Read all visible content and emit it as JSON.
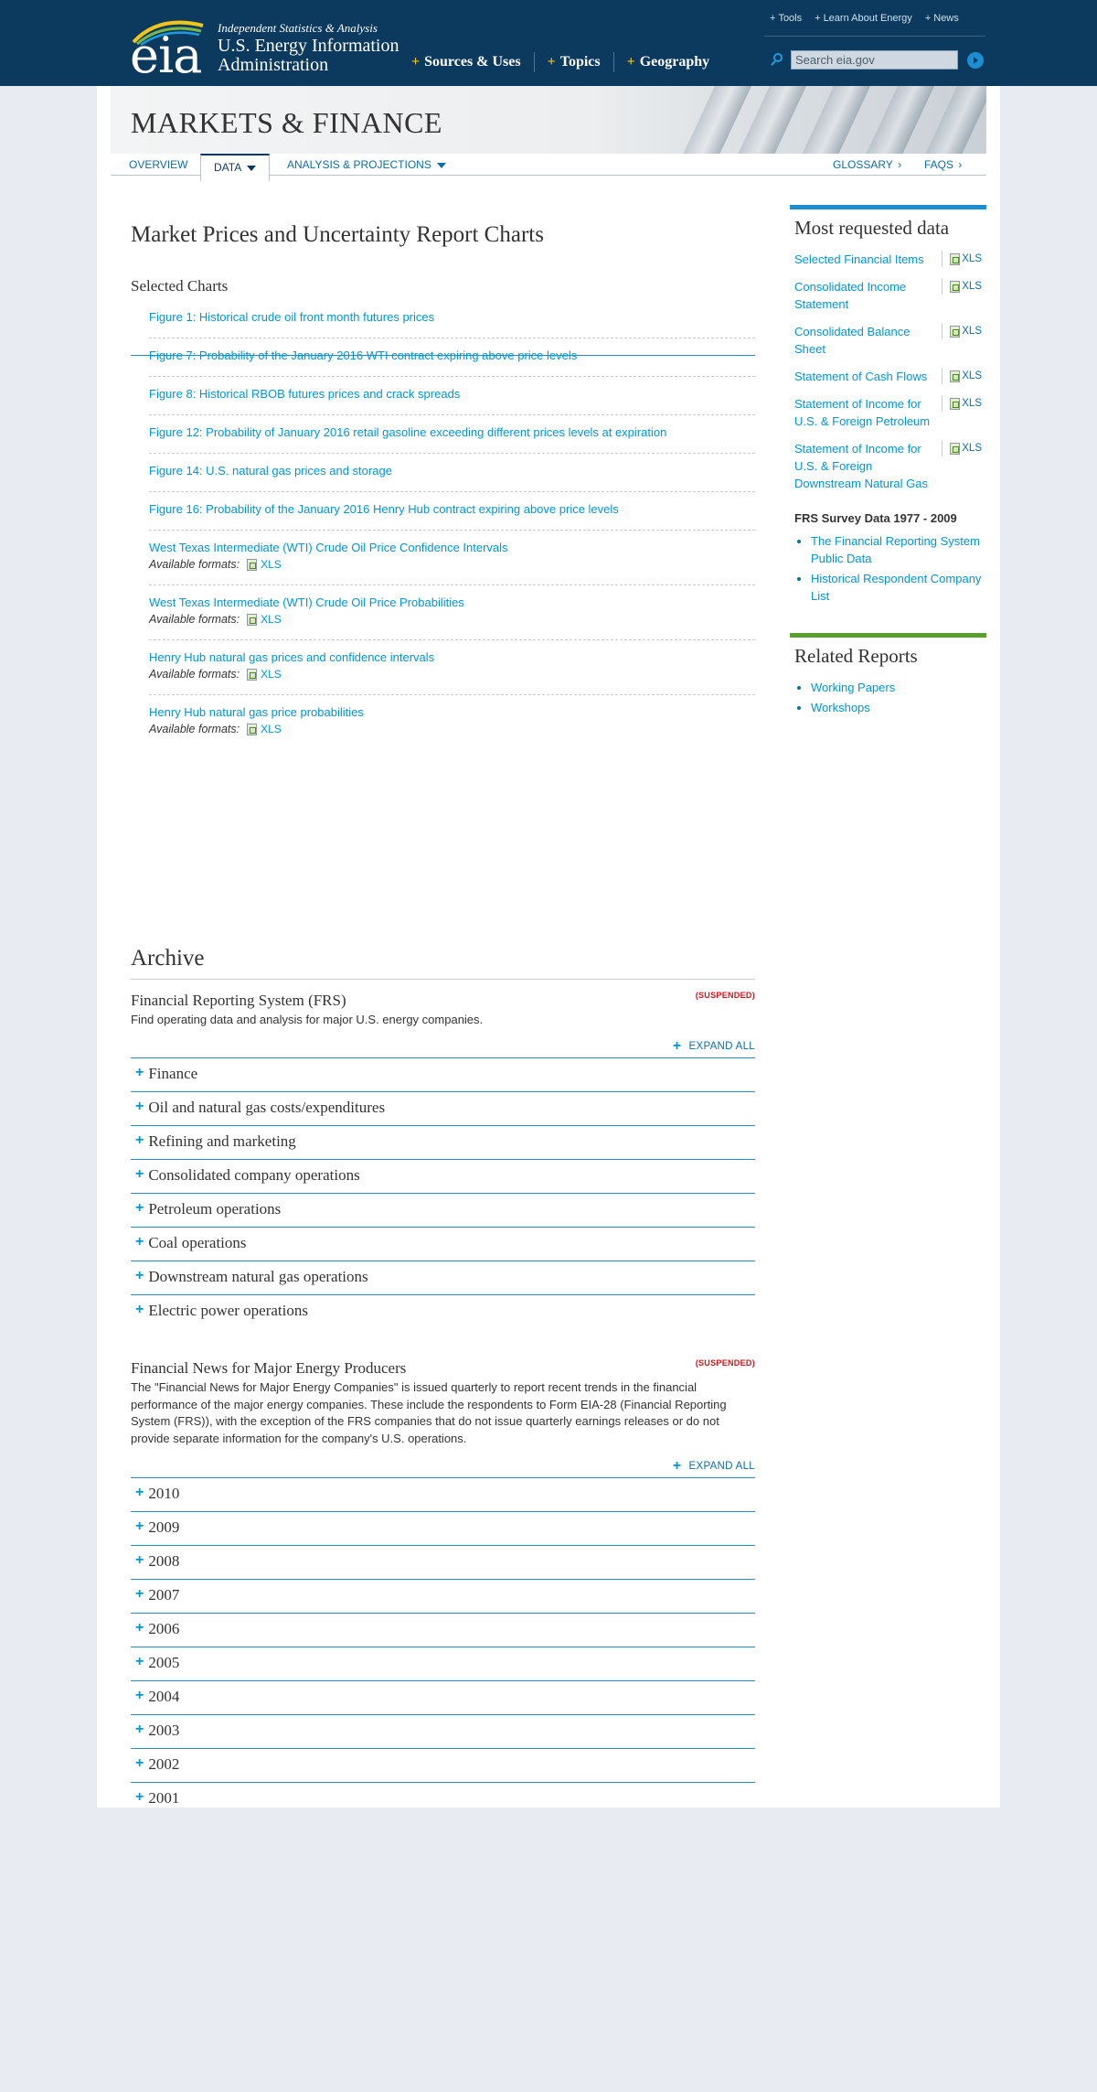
{
  "header": {
    "logo_text": "eia",
    "tagline": "Independent Statistics & Analysis",
    "org_name": "U.S. Energy Information Administration",
    "util_links": [
      "Tools",
      "Learn About Energy",
      "News"
    ],
    "main_nav": [
      "Sources & Uses",
      "Topics",
      "Geography"
    ],
    "search_placeholder": "Search eia.gov"
  },
  "page": {
    "section_title": "MARKETS & FINANCE",
    "subnav": {
      "overview": "OVERVIEW",
      "data": "DATA",
      "analysis": "ANALYSIS & PROJECTIONS",
      "glossary": "GLOSSARY",
      "faqs": "FAQS"
    }
  },
  "main": {
    "title": "Market Prices and Uncertainty Report Charts",
    "selected_heading": "Selected Charts",
    "available_formats_label": "Available formats:",
    "format_xls": "XLS",
    "charts": [
      {
        "label": "Figure 1: Historical crude oil front month futures prices"
      },
      {
        "label": "Figure 7: Probability of the January 2016 WTI contract expiring above price levels"
      },
      {
        "label": "Figure 8: Historical RBOB futures prices and crack spreads"
      },
      {
        "label": "Figure 12: Probability of January 2016 retail gasoline exceeding different prices levels at expiration"
      },
      {
        "label": "Figure 14: U.S. natural gas prices and storage"
      },
      {
        "label": "Figure 16: Probability of the January 2016 Henry Hub contract expiring above price levels"
      }
    ],
    "data_charts": [
      {
        "label": "West Texas Intermediate (WTI) Crude Oil Price Confidence Intervals"
      },
      {
        "label": "West Texas Intermediate (WTI) Crude Oil Price Probabilities"
      },
      {
        "label": "Henry Hub natural gas prices and confidence intervals"
      },
      {
        "label": "Henry Hub natural gas price probabilities"
      }
    ],
    "archive_heading": "Archive",
    "frs": {
      "title": "Financial Reporting System (FRS)",
      "badge": "(SUSPENDED)",
      "desc": "Find operating data and analysis for major U.S. energy companies.",
      "expand_all": "EXPAND ALL",
      "items": [
        "Finance",
        "Oil and natural gas costs/expenditures",
        "Refining and marketing",
        "Consolidated company operations",
        "Petroleum operations",
        "Coal operations",
        "Downstream natural gas operations",
        "Electric power operations"
      ]
    },
    "news": {
      "title": "Financial News for Major Energy Producers",
      "badge": "(SUSPENDED)",
      "desc": "The \"Financial News for Major Energy Companies\" is issued quarterly to report recent trends in the financial performance of the major energy companies. These include the respondents to Form EIA-28 (Financial Reporting System (FRS)), with the exception of the FRS companies that do not issue quarterly earnings releases or do not provide separate information for the company's U.S. operations.",
      "expand_all": "EXPAND ALL",
      "years": [
        "2010",
        "2009",
        "2008",
        "2007",
        "2006",
        "2005",
        "2004",
        "2003",
        "2002",
        "2001"
      ]
    }
  },
  "sidebar": {
    "most_requested_title": "Most requested data",
    "xls": "XLS",
    "most_requested": [
      {
        "label": "Selected Financial Items"
      },
      {
        "label": "Consolidated Income Statement"
      },
      {
        "label": "Consolidated Balance Sheet"
      },
      {
        "label": "Statement of Cash Flows"
      },
      {
        "label": "Statement of Income for U.S. & Foreign Petroleum"
      },
      {
        "label": "Statement of Income for U.S. & Foreign Downstream Natural Gas"
      }
    ],
    "frs_survey_title": "FRS Survey Data 1977 - 2009",
    "frs_survey_links": [
      "The Financial Reporting System Public Data",
      "Historical Respondent Company List"
    ],
    "related_title": "Related Reports",
    "related_links": [
      "Working Papers",
      "Workshops"
    ]
  },
  "colors": {
    "header_bg": "#0b3a5e",
    "link": "#0096d6",
    "accent_blue": "#1b8fd1",
    "accent_green": "#5b9e2f",
    "suspended_red": "#d4141a",
    "page_bg": "#e8ebf2"
  }
}
